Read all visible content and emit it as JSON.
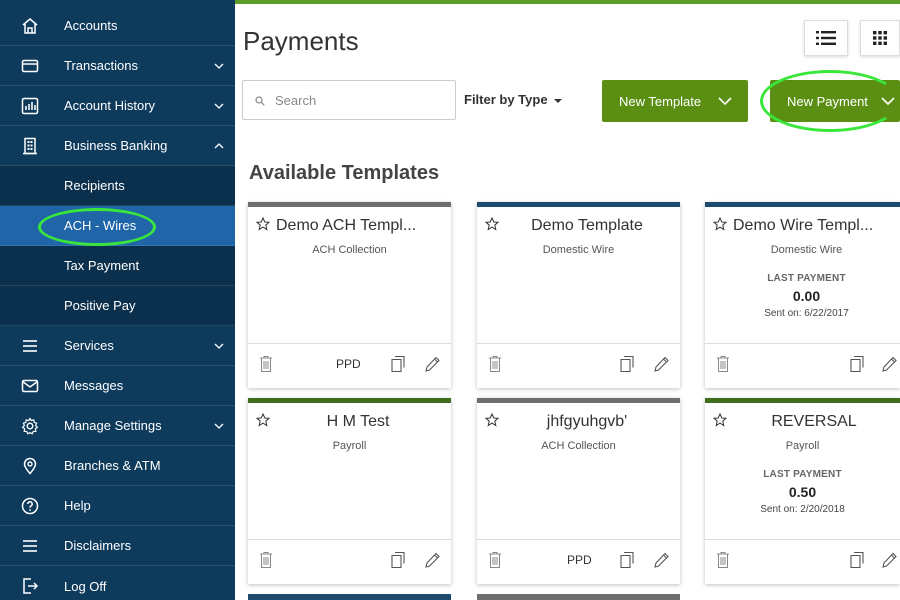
{
  "sidebar": {
    "items": [
      {
        "label": "Accounts",
        "icon": "home-icon"
      },
      {
        "label": "Transactions",
        "icon": "card-icon"
      },
      {
        "label": "Account History",
        "icon": "chart-icon"
      },
      {
        "label": "Business Banking",
        "icon": "building-icon"
      },
      {
        "label": "Services",
        "icon": "menu-icon"
      },
      {
        "label": "Messages",
        "icon": "envelope-icon"
      },
      {
        "label": "Manage Settings",
        "icon": "gear-icon"
      },
      {
        "label": "Branches & ATM",
        "icon": "location-pin-icon"
      },
      {
        "label": "Help",
        "icon": "question-circle-icon"
      },
      {
        "label": "Disclaimers",
        "icon": "menu-icon"
      },
      {
        "label": "Log Off",
        "icon": "logout-icon"
      }
    ],
    "subitems": [
      {
        "label": "Recipients"
      },
      {
        "label": "ACH - Wires",
        "active": true
      },
      {
        "label": "Tax Payment"
      },
      {
        "label": "Positive Pay"
      }
    ]
  },
  "header": {
    "title": "Payments",
    "search_placeholder": "Search",
    "filter_label": "Filter by Type",
    "new_template_label": "New Template",
    "new_payment_label": "New Payment"
  },
  "section": {
    "title": "Available Templates"
  },
  "cards": [
    {
      "title": "Demo ACH Templ...",
      "subtitle": "ACH Collection",
      "footer_tag": "PPD"
    },
    {
      "title": "Demo Template",
      "subtitle": "Domestic Wire",
      "footer_tag": ""
    },
    {
      "title": "Demo Wire Templ...",
      "subtitle": "Domestic Wire",
      "last_payment_label": "LAST PAYMENT",
      "last_payment_amount": "0.00",
      "sent_on": "Sent on: 6/22/2017",
      "footer_tag": ""
    },
    {
      "title": "H M Test",
      "subtitle": "Payroll",
      "footer_tag": ""
    },
    {
      "title": "jhfgyuhgvb'",
      "subtitle": "ACH Collection",
      "footer_tag": "PPD"
    },
    {
      "title": "REVERSAL",
      "subtitle": "Payroll",
      "last_payment_label": "LAST PAYMENT",
      "last_payment_amount": "0.50",
      "sent_on": "Sent on: 2/20/2018",
      "footer_tag": ""
    }
  ],
  "colors": {
    "sidebar_bg": "#0e3a5c",
    "active_item": "#1f65a8",
    "primary_button": "#5b8f14",
    "highlight_ring": "#39e639"
  }
}
